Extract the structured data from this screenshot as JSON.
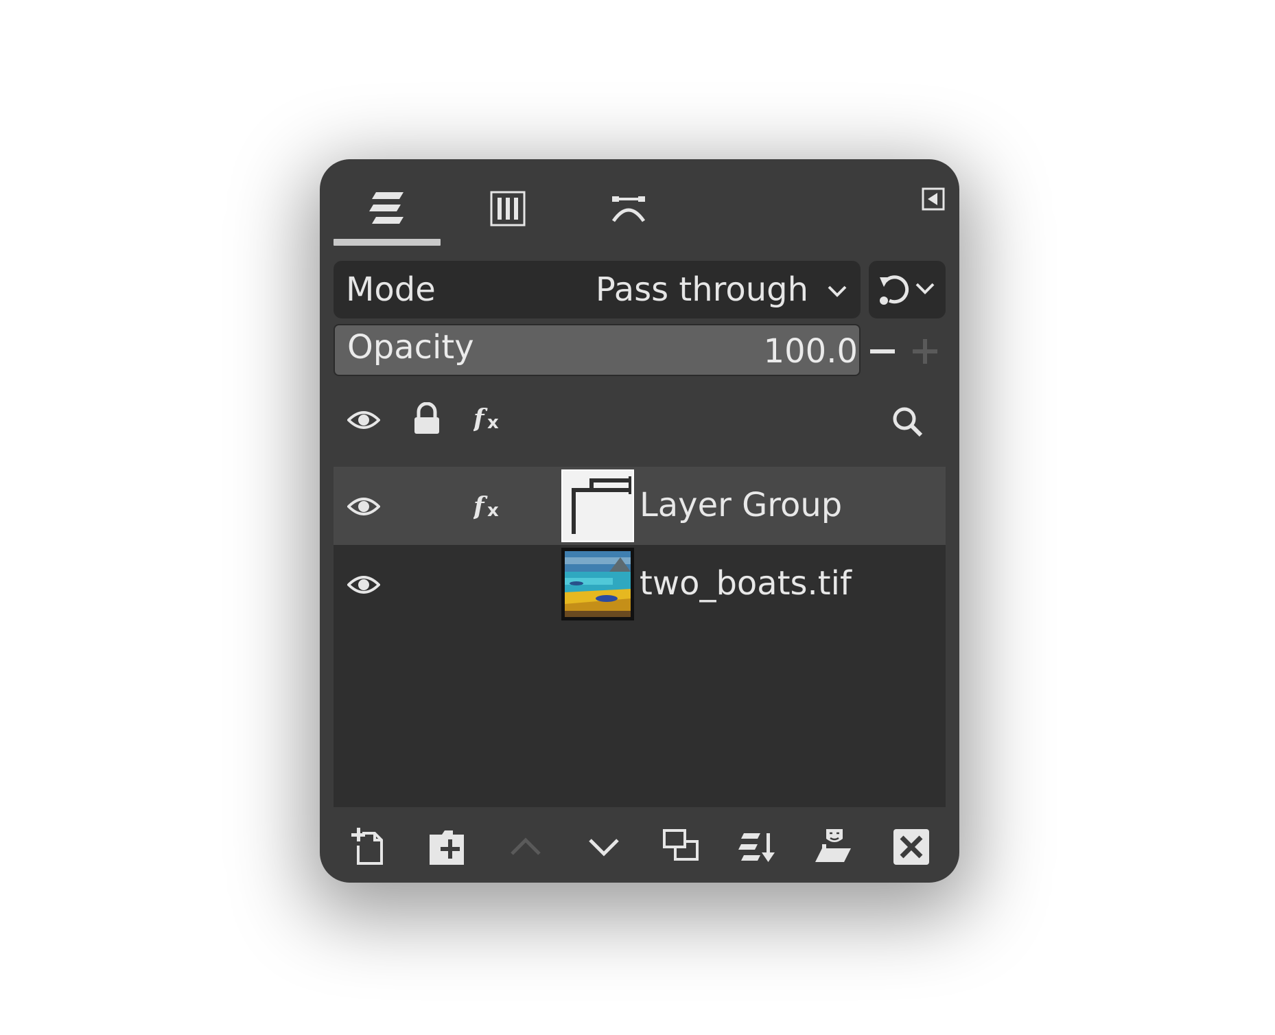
{
  "tabs": [
    {
      "icon": "layers-icon",
      "active": true
    },
    {
      "icon": "channels-icon",
      "active": false
    },
    {
      "icon": "paths-icon",
      "active": false
    }
  ],
  "dock_menu_icon": "tab-menu-icon",
  "mode": {
    "label": "Mode",
    "value": "Pass through"
  },
  "opacity": {
    "label": "Opacity",
    "value": "100.0"
  },
  "header_icons": [
    "visibility-icon",
    "lock-icon",
    "fx-icon",
    "search-icon"
  ],
  "layers": [
    {
      "name": "Layer Group",
      "visible": true,
      "has_fx": true,
      "selected": true,
      "thumb": "layer-group-thumbnail"
    },
    {
      "name": "two_boats.tif",
      "visible": true,
      "has_fx": false,
      "selected": false,
      "thumb": "image-thumbnail"
    }
  ],
  "bottom_buttons": [
    "new-layer-icon",
    "new-layer-group-icon",
    "raise-layer-icon",
    "lower-layer-icon",
    "duplicate-layer-icon",
    "merge-down-icon",
    "anchor-layer-icon",
    "delete-layer-icon"
  ],
  "colors": {
    "panel": "#3c3c3c",
    "list_bg": "#2f2f2f",
    "selected_row": "#484848",
    "text": "#e8e8e8",
    "disabled": "#5a5a5a"
  }
}
